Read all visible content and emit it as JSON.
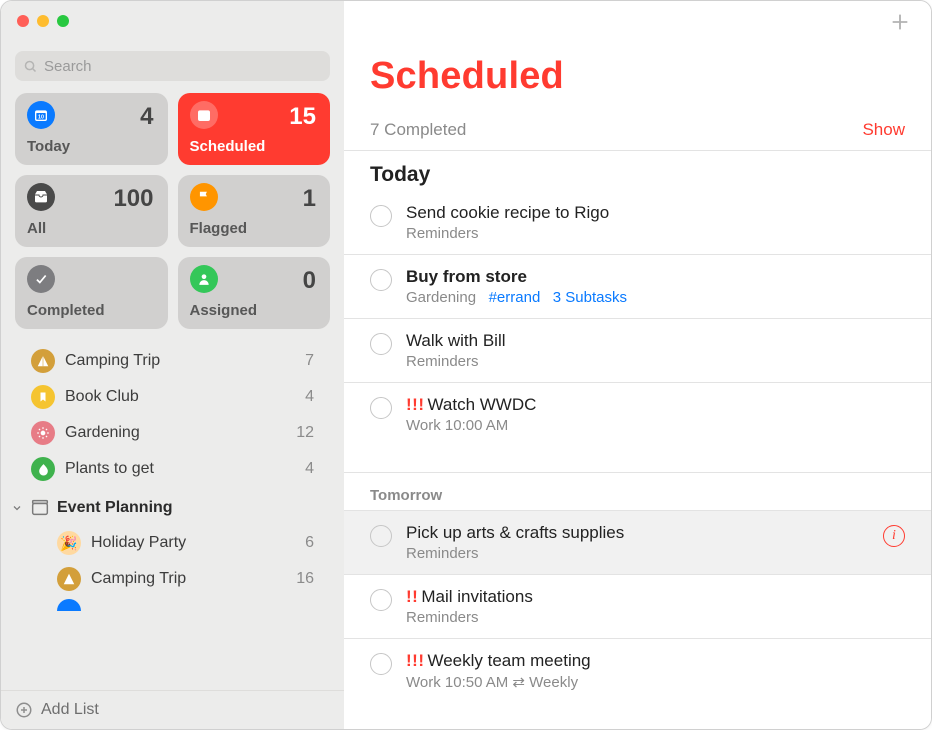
{
  "search": {
    "placeholder": "Search"
  },
  "tiles": {
    "today": {
      "label": "Today",
      "count": 4
    },
    "scheduled": {
      "label": "Scheduled",
      "count": 15
    },
    "all": {
      "label": "All",
      "count": 100
    },
    "flagged": {
      "label": "Flagged",
      "count": 1
    },
    "completed": {
      "label": "Completed",
      "count": ""
    },
    "assigned": {
      "label": "Assigned",
      "count": 0
    }
  },
  "lists": [
    {
      "name": "Camping Trip",
      "count": 7,
      "icon": "tent",
      "color": "#d39f3a"
    },
    {
      "name": "Book Club",
      "count": 4,
      "icon": "bookmark",
      "color": "#f5c430"
    },
    {
      "name": "Gardening",
      "count": 12,
      "icon": "sun",
      "color": "#e77c86"
    },
    {
      "name": "Plants to get",
      "count": 4,
      "icon": "leaf",
      "color": "#3fb24d"
    }
  ],
  "folder": {
    "name": "Event Planning",
    "children": [
      {
        "name": "Holiday Party",
        "count": 6,
        "icon": "party",
        "color": "#ffd9a0"
      },
      {
        "name": "Camping Trip",
        "count": 16,
        "icon": "tent",
        "color": "#d39f3a"
      }
    ]
  },
  "addList": "Add List",
  "main": {
    "title": "Scheduled",
    "completed_label": "7 Completed",
    "show_label": "Show",
    "sections": {
      "today": "Today",
      "tomorrow": "Tomorrow"
    },
    "reminders_today": [
      {
        "title": "Send cookie recipe to Rigo",
        "meta": "Reminders"
      },
      {
        "title": "Buy from store",
        "bold": true,
        "meta_list": "Gardening",
        "tag": "#errand",
        "subtasks": "3 Subtasks"
      },
      {
        "title": "Walk with Bill",
        "meta": "Reminders"
      },
      {
        "priority": "!!!",
        "title": "Watch WWDC",
        "meta": "Work  10:00 AM"
      }
    ],
    "reminders_tomorrow": [
      {
        "title": "Pick up arts & crafts supplies",
        "meta": "Reminders",
        "selected": true,
        "info": true
      },
      {
        "priority": "!!",
        "title": "Mail invitations",
        "meta": "Reminders"
      },
      {
        "priority": "!!!",
        "title": "Weekly team meeting",
        "meta": "Work  10:50 AM  ⇄  Weekly"
      }
    ]
  }
}
